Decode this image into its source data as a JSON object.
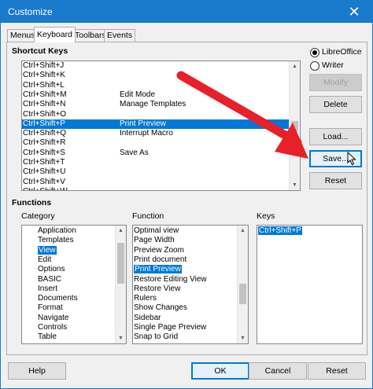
{
  "window": {
    "title": "Customize",
    "close_glyph": "✕"
  },
  "tabs": [
    {
      "label": "Menus",
      "active": false
    },
    {
      "label": "Keyboard",
      "active": true
    },
    {
      "label": "Toolbars",
      "active": false
    },
    {
      "label": "Events",
      "active": false
    }
  ],
  "shortcut_keys": {
    "label": "Shortcut Keys",
    "selected_index": 5,
    "rows": [
      {
        "key": "Ctrl+Shift+J",
        "command": ""
      },
      {
        "key": "Ctrl+Shift+K",
        "command": ""
      },
      {
        "key": "Ctrl+Shift+L",
        "command": ""
      },
      {
        "key": "Ctrl+Shift+M",
        "command": "Edit Mode"
      },
      {
        "key": "Ctrl+Shift+N",
        "command": "Manage Templates"
      },
      {
        "key": "Ctrl+Shift+O",
        "command": ""
      },
      {
        "key": "Ctrl+Shift+P",
        "command": "Print Preview"
      },
      {
        "key": "Ctrl+Shift+Q",
        "command": "Interrupt Macro"
      },
      {
        "key": "Ctrl+Shift+R",
        "command": ""
      },
      {
        "key": "Ctrl+Shift+S",
        "command": "Save As"
      },
      {
        "key": "Ctrl+Shift+T",
        "command": ""
      },
      {
        "key": "Ctrl+Shift+U",
        "command": ""
      },
      {
        "key": "Ctrl+Shift+V",
        "command": ""
      },
      {
        "key": "Ctrl+Shift+W",
        "command": ""
      }
    ]
  },
  "scope": {
    "options": [
      {
        "label": "LibreOffice",
        "checked": true
      },
      {
        "label": "Writer",
        "checked": false
      }
    ]
  },
  "side_buttons": {
    "modify": "Modify",
    "delete": "Delete",
    "load": "Load...",
    "save": "Save...",
    "reset": "Reset"
  },
  "functions": {
    "label": "Functions",
    "category_label": "Category",
    "function_label": "Function",
    "keys_label": "Keys",
    "categories": [
      "Application",
      "Templates",
      "View",
      "Edit",
      "Options",
      "BASIC",
      "Insert",
      "Documents",
      "Format",
      "Navigate",
      "Controls",
      "Table"
    ],
    "selected_category": "View",
    "function_items": [
      "Optimal view",
      "Page Width",
      "Preview Zoom",
      "Print document",
      "Print Preview",
      "Restore Editing View",
      "Restore View",
      "Rulers",
      "Show Changes",
      "Sidebar",
      "Single Page Preview",
      "Snap to Grid"
    ],
    "selected_function": "Print Preview",
    "keys": [
      "Ctrl+Shift+P"
    ]
  },
  "footer": {
    "help": "Help",
    "ok": "OK",
    "cancel": "Cancel",
    "reset": "Reset"
  },
  "colors": {
    "titlebar": "#1979ca",
    "selection": "#0078d7",
    "arrow": "#e8202a"
  },
  "icons": {
    "close": "close-icon",
    "arrow": "red-arrow-annotation",
    "cursor": "mouse-pointer-icon"
  }
}
